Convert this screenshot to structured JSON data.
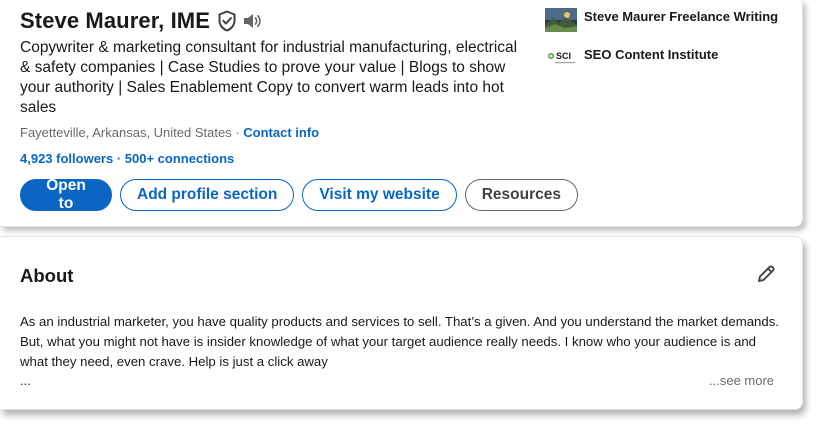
{
  "profile": {
    "name": "Steve Maurer, IME",
    "headline": "Copywriter & marketing consultant for industrial manufacturing, electrical & safety companies | Case Studies to prove your value | Blogs to show your authority | Sales Enablement Copy to convert warm leads into hot sales",
    "location": "Fayetteville, Arkansas, United States",
    "location_sep": " · ",
    "contact_info": "Contact info",
    "followers": "4,923 followers",
    "followers_sep": " · ",
    "connections": "500+ connections",
    "verified_icon": "shield-check-icon",
    "pronunciation_icon": "speaker-icon"
  },
  "actions": {
    "open_to": "Open to",
    "add_profile_section": "Add profile section",
    "visit_website": "Visit my website",
    "resources": "Resources"
  },
  "experience": [
    {
      "name": "Steve Maurer Freelance Writing",
      "logo": "landscape-logo"
    },
    {
      "name": "SEO Content Institute",
      "logo": "sci-logo"
    }
  ],
  "about": {
    "title": "About",
    "text": "As an industrial marketer, you have quality products and services to sell. That’s a given. And you understand the market demands. But, what you might not have is insider knowledge of what your target audience really needs. I know who your audience is and what they need, even crave. Help is just a click away",
    "ellipsis": "...",
    "see_more": "...see more",
    "edit_icon": "pencil-icon"
  },
  "colors": {
    "brand_blue": "#0a66c2",
    "text_primary": "#191919",
    "text_secondary": "#666666"
  }
}
